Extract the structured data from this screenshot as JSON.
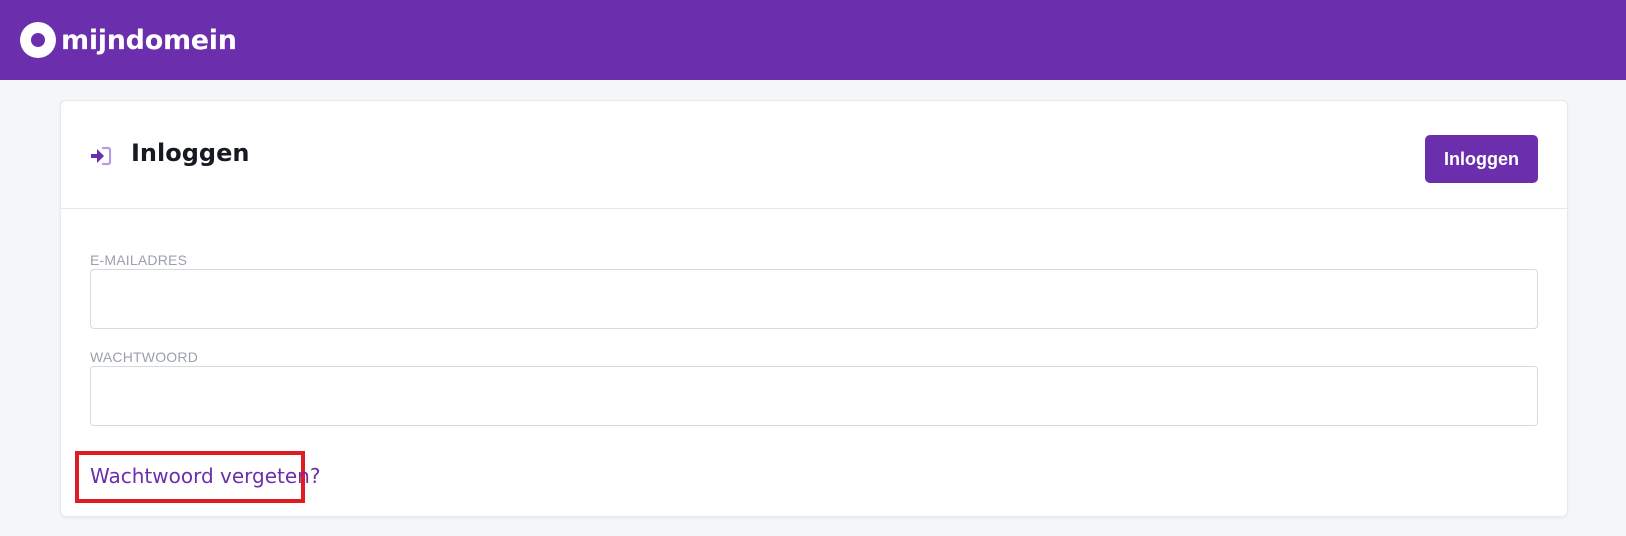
{
  "brand": {
    "name": "mijndomein",
    "color": "#6b2fad"
  },
  "header": {
    "icon": "sign-in-icon",
    "title": "Inloggen",
    "login_button": "Inloggen"
  },
  "form": {
    "email": {
      "label": "E-MAILADRES",
      "value": ""
    },
    "password": {
      "label": "WACHTWOORD",
      "value": ""
    },
    "forgot_link": "Wachtwoord vergeten?"
  },
  "highlight_color": "#e01b24"
}
